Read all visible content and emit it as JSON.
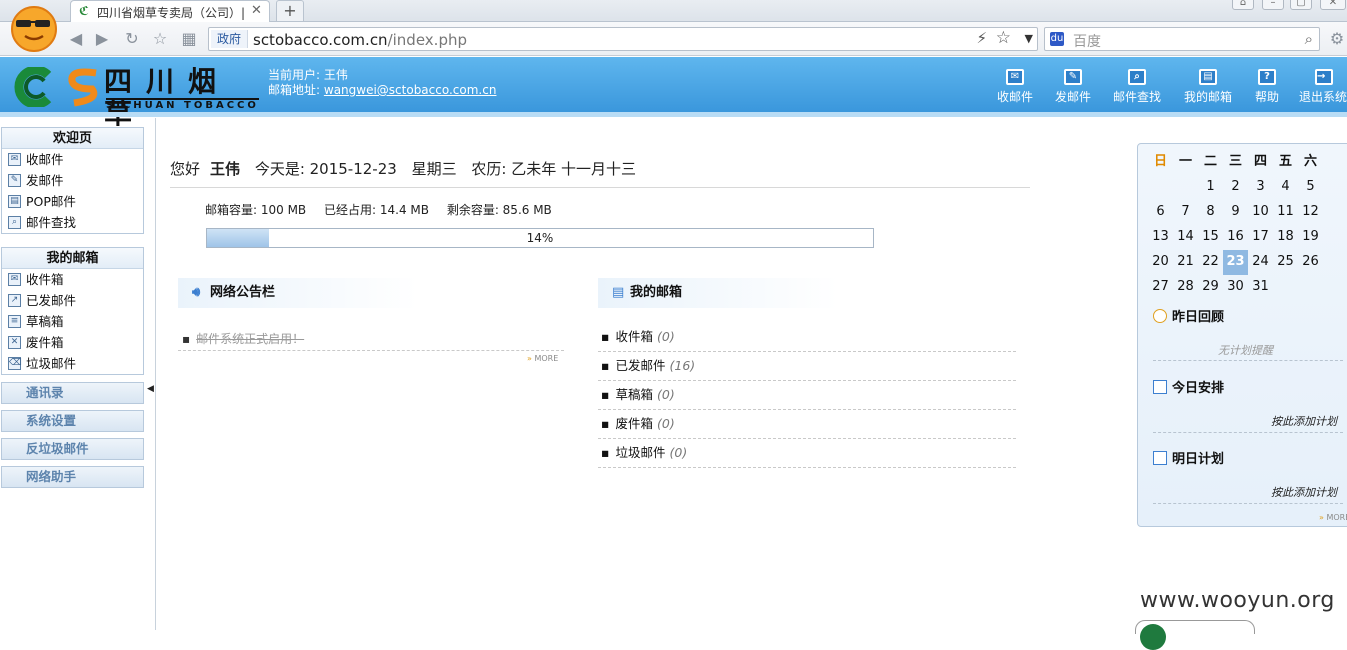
{
  "browser": {
    "tab_title": "四川省烟草专卖局（公司）|",
    "url_tag": "政府",
    "url_host": "sctobacco.com.cn",
    "url_path": "/index.php",
    "search_placeholder": "百度",
    "new_tab_label": "+"
  },
  "header": {
    "brand_cn": "四川烟草",
    "brand_en": "SICHUAN TOBACCO",
    "user_label": "当前用户: 王伟",
    "email_label": "邮箱地址:",
    "email": "wangwei@sctobacco.com.cn",
    "toolbar": [
      {
        "label": "收邮件",
        "icon": "inbox-icon"
      },
      {
        "label": "发邮件",
        "icon": "compose-icon"
      },
      {
        "label": "邮件查找",
        "icon": "mail-search-icon"
      },
      {
        "label": "我的邮箱",
        "icon": "mailbox-icon"
      },
      {
        "label": "帮助",
        "icon": "help-icon",
        "glyph": "?"
      },
      {
        "label": "退出系统",
        "icon": "logout-icon",
        "glyph": "→"
      }
    ]
  },
  "sidebar": {
    "welcome": {
      "title": "欢迎页",
      "items": [
        {
          "label": "收邮件",
          "icon": "receive-mail-icon"
        },
        {
          "label": "发邮件",
          "icon": "send-mail-icon"
        },
        {
          "label": "POP邮件",
          "icon": "pop-mail-icon"
        },
        {
          "label": "邮件查找",
          "icon": "search-mail-icon"
        }
      ]
    },
    "mailbox": {
      "title": "我的邮箱",
      "items": [
        {
          "label": "收件箱",
          "icon": "inbox-folder-icon"
        },
        {
          "label": "已发邮件",
          "icon": "sent-folder-icon"
        },
        {
          "label": "草稿箱",
          "icon": "drafts-folder-icon"
        },
        {
          "label": "废件箱",
          "icon": "deleted-folder-icon"
        },
        {
          "label": "垃圾邮件",
          "icon": "junk-folder-icon"
        }
      ]
    },
    "sections": [
      "通讯录",
      "系统设置",
      "反垃圾邮件",
      "网络助手"
    ]
  },
  "main": {
    "greeting_prefix": "您好",
    "user_name": "王伟",
    "today": "今天是: 2015-12-23",
    "weekday": "星期三",
    "lunar": "农历: 乙未年  十一月十三",
    "quota": {
      "capacity": "邮箱容量: 100 MB",
      "used": "已经占用: 14.4 MB",
      "remaining": "剩余容量: 85.6 MB",
      "percent_text": "14%",
      "fraction": 0.14
    },
    "notice_board": {
      "title": "网络公告栏",
      "items": [
        "邮件系统正式启用！"
      ],
      "more": "MORE"
    },
    "my_mailbox": {
      "title": "我的邮箱",
      "folders": [
        {
          "name": "收件箱",
          "count": "(0)"
        },
        {
          "name": "已发邮件",
          "count": "(16)"
        },
        {
          "name": "草稿箱",
          "count": "(0)"
        },
        {
          "name": "废件箱",
          "count": "(0)"
        },
        {
          "name": "垃圾邮件",
          "count": "(0)"
        }
      ]
    }
  },
  "calendar": {
    "weekdays": [
      "日",
      "一",
      "二",
      "三",
      "四",
      "五",
      "六"
    ],
    "weeks": [
      [
        "",
        "",
        "1",
        "2",
        "3",
        "4",
        "5"
      ],
      [
        "6",
        "7",
        "8",
        "9",
        "10",
        "11",
        "12"
      ],
      [
        "13",
        "14",
        "15",
        "16",
        "17",
        "18",
        "19"
      ],
      [
        "20",
        "21",
        "22",
        "23",
        "24",
        "25",
        "26"
      ],
      [
        "27",
        "28",
        "29",
        "30",
        "31",
        "",
        ""
      ]
    ],
    "today": "23",
    "yesterday": {
      "title": "昨日回顾",
      "note": "无计划提醒"
    },
    "today_plan": {
      "title": "今日安排",
      "add": "按此添加计划"
    },
    "tomorrow": {
      "title": "明日计划",
      "add": "按此添加计划"
    },
    "more": "MORE"
  },
  "watermark": "www.wooyun.org",
  "colors": {
    "header_top": "#5fb6ee",
    "header_bottom": "#3a97dc",
    "accent": "#3c7fd0"
  }
}
